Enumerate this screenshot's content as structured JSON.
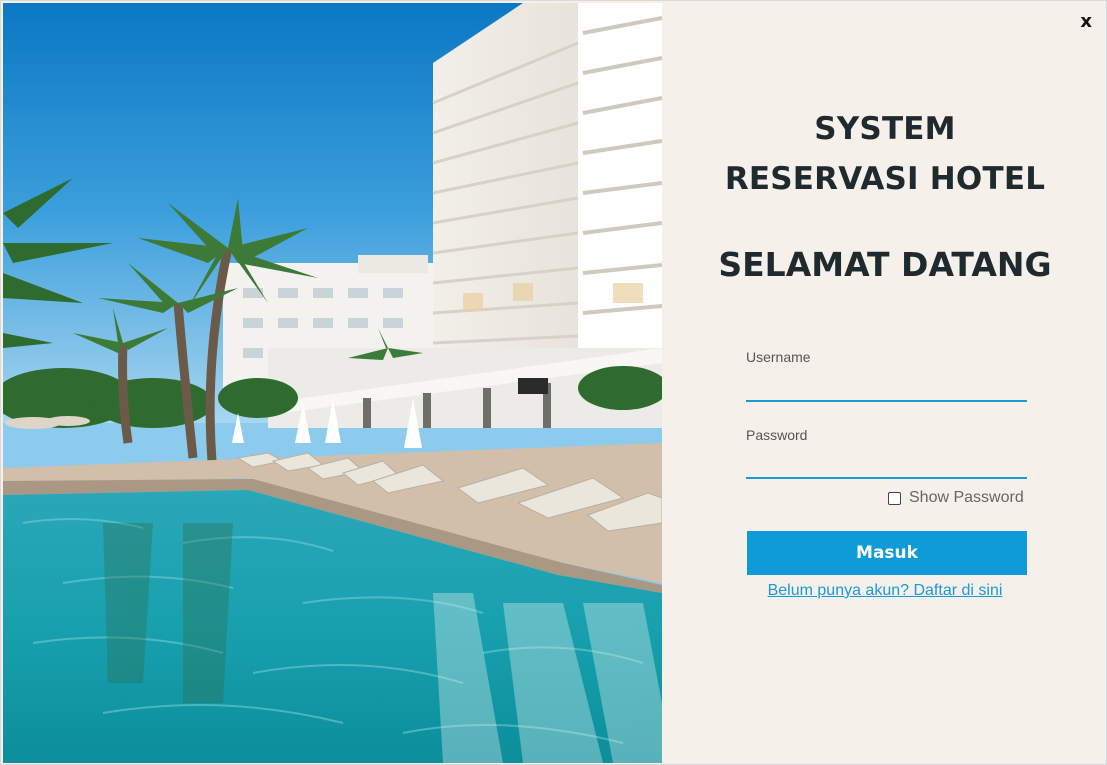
{
  "window": {
    "close_label": "x"
  },
  "hero_image": {
    "description_icon": "hotel-pool-photo"
  },
  "heading": {
    "line1": "SYSTEM",
    "line2": "RESERVASI HOTEL",
    "welcome": "SELAMAT DATANG"
  },
  "form": {
    "username_label": "Username",
    "username_value": "",
    "password_label": "Password",
    "password_value": "",
    "show_password_label": "Show Password",
    "show_password_checked": false,
    "submit_label": "Masuk",
    "register_link": "Belum punya akun? Daftar di sini"
  },
  "colors": {
    "accent": "#0e9bd8",
    "panel_background": "#f6f0eb",
    "title_text": "#1f2a2f"
  }
}
